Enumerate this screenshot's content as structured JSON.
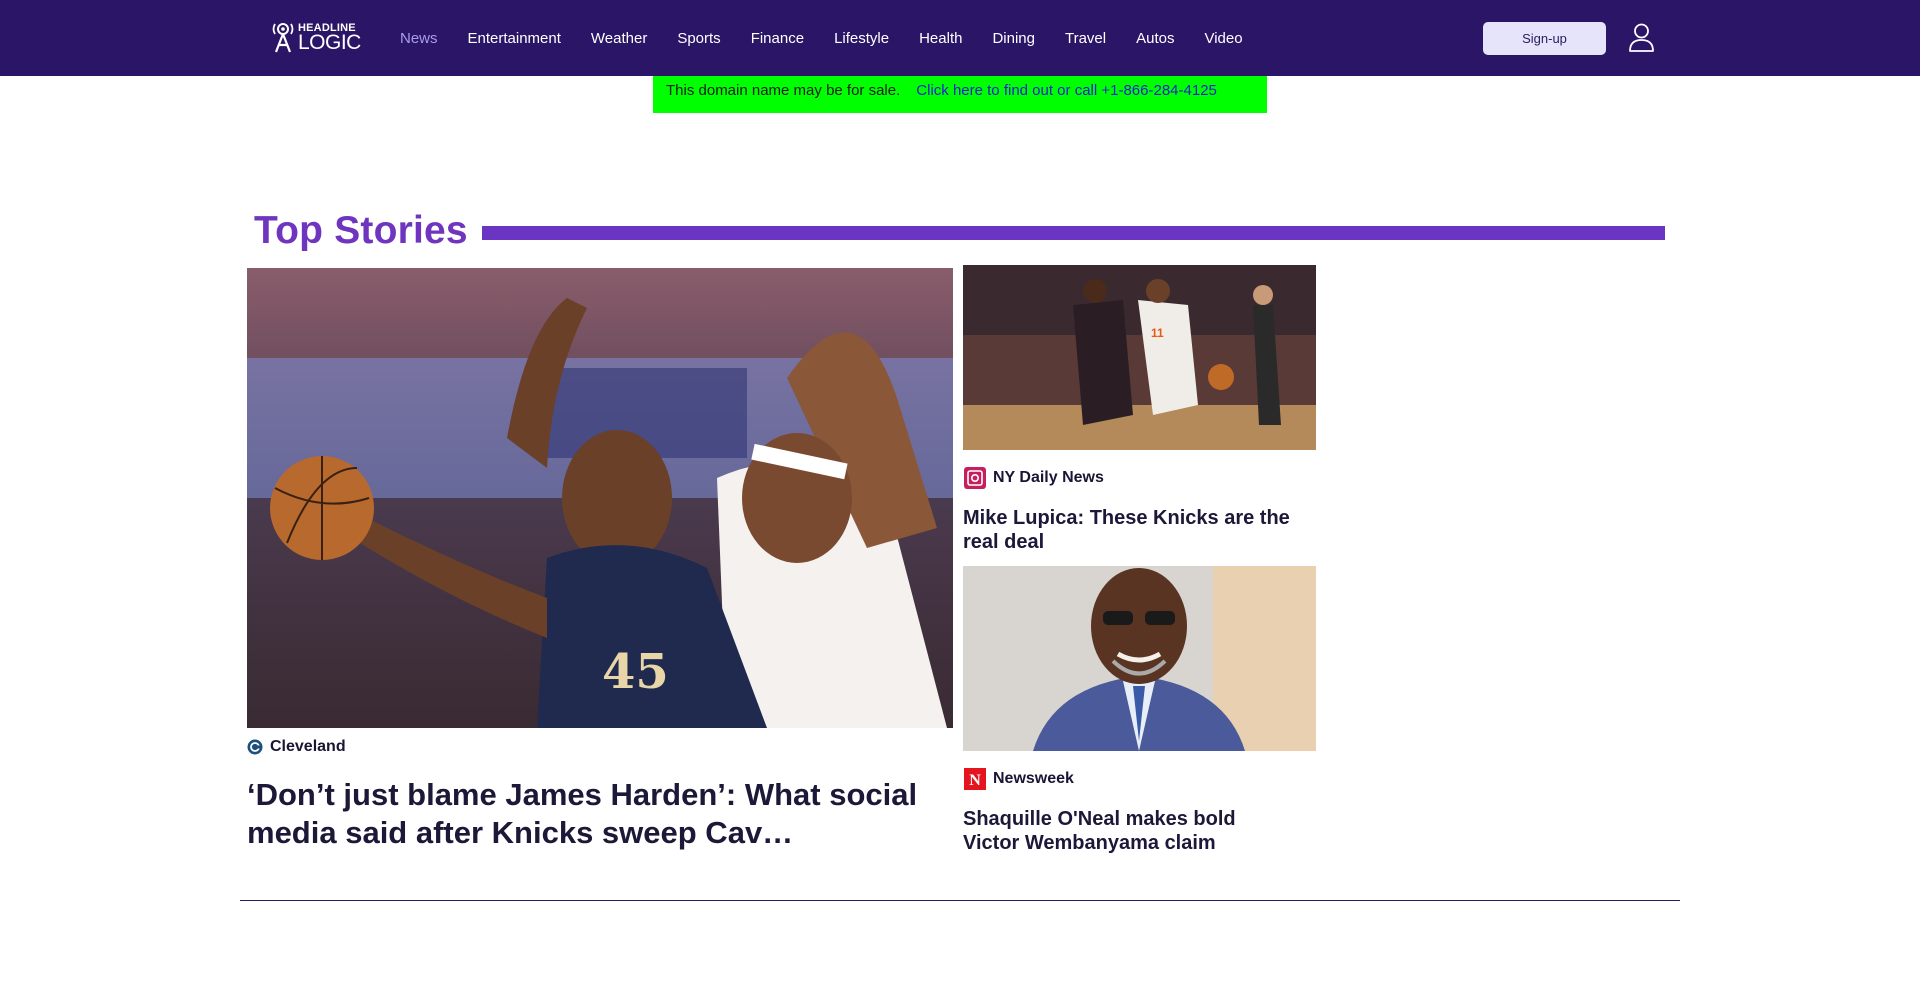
{
  "header": {
    "logo": {
      "line1": "HEADLINE",
      "line2": "LOGIC"
    },
    "nav": [
      "News",
      "Entertainment",
      "Weather",
      "Sports",
      "Finance",
      "Lifestyle",
      "Health",
      "Dining",
      "Travel",
      "Autos",
      "Video"
    ],
    "active_nav": "News",
    "signup_label": "Sign-up",
    "background": "#2b1566"
  },
  "banner": {
    "text": "This domain name may be for sale.",
    "link": "Click here to find out or call +1-866-284-4125",
    "background": "#00ff00"
  },
  "top_stories": {
    "title": "Top Stories",
    "accent": "#6a35c2",
    "main": {
      "source": "Cleveland",
      "headline": "‘Don’t just blame James Harden’: What social media said after Knicks sweep Cav…"
    },
    "side": [
      {
        "source": "NY Daily News",
        "headline": "Mike Lupica: These Knicks are the real deal"
      },
      {
        "source": "Newsweek",
        "headline": "Shaquille O'Neal makes bold Victor Wembanyama claim"
      }
    ]
  }
}
